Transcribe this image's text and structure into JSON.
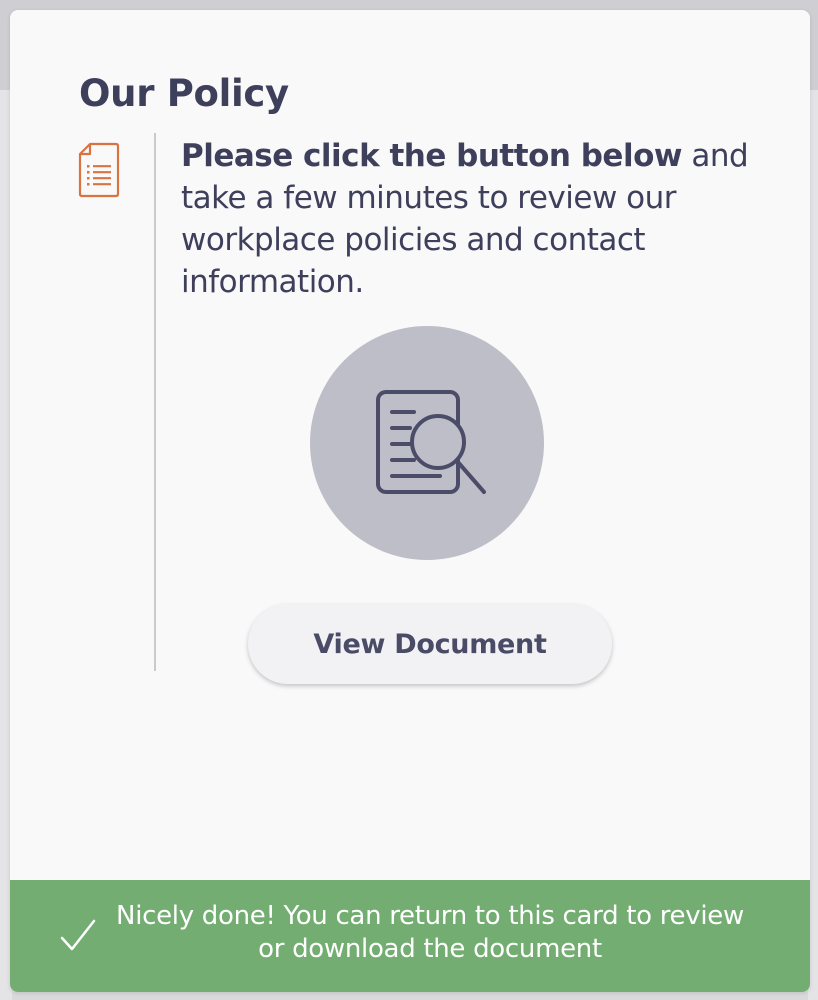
{
  "card": {
    "title": "Our Policy",
    "intro_bold": "Please click the button below",
    "intro_rest": " and take a few minutes to review our workplace policies and contact information.",
    "view_button_label": "View Document"
  },
  "toast": {
    "message": "Nicely done! You can return to this card to review or download the document"
  },
  "icons": {
    "header_icon": "document-list-icon",
    "hero_icon": "document-search-icon",
    "toast_icon": "check-icon"
  },
  "colors": {
    "accent_orange": "#d9733f",
    "text_dark": "#3e3f5b",
    "hero_circle": "#bebec8",
    "success_green": "#73ad71"
  }
}
